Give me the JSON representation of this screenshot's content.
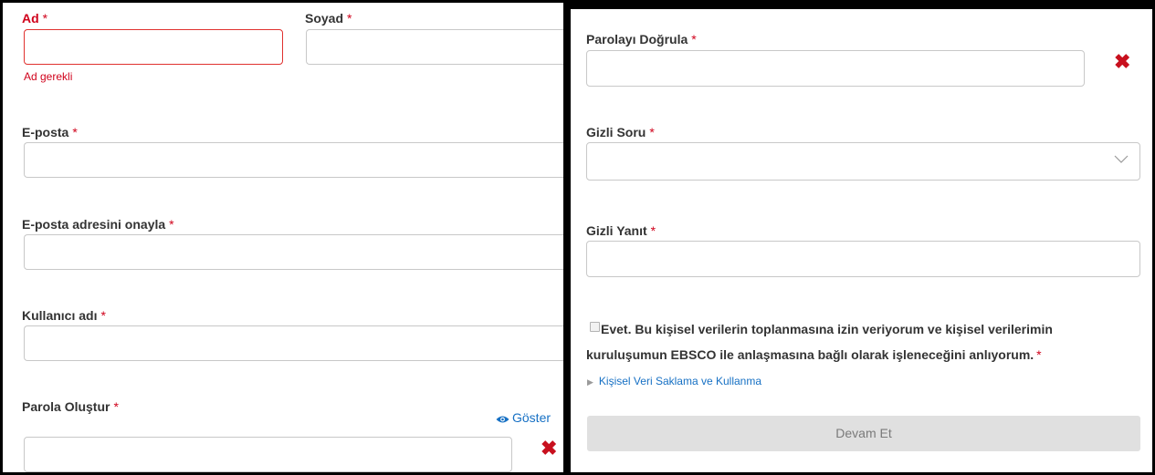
{
  "left_form": {
    "first_name": {
      "label": "Ad",
      "required": "*",
      "value": "",
      "error": "Ad gerekli"
    },
    "last_name": {
      "label": "Soyad",
      "required": "*",
      "value": ""
    },
    "email": {
      "label": "E-posta",
      "required": "*",
      "value": ""
    },
    "email_confirm": {
      "label": "E-posta adresini onayla",
      "required": "*",
      "value": ""
    },
    "username": {
      "label": "Kullanıcı adı",
      "required": "*",
      "value": ""
    },
    "password": {
      "label": "Parola Oluştur",
      "required": "*",
      "value": "",
      "show_label": "Göster"
    }
  },
  "right_form": {
    "password_confirm": {
      "label": "Parolayı Doğrula",
      "required": "*",
      "value": ""
    },
    "secret_question": {
      "label": "Gizli Soru",
      "required": "*",
      "selected": ""
    },
    "secret_answer": {
      "label": "Gizli Yanıt",
      "required": "*",
      "value": ""
    },
    "consent": {
      "text": "Evet. Bu kişisel verilerin toplanmasına izin veriyorum ve kişisel verilerimin kuruluşumun EBSCO ile anlaşmasına bağlı olarak işleneceğini anlıyorum.",
      "required": "*",
      "checked": false
    },
    "privacy_link": "Kişisel Veri Saklama ve Kullanma",
    "submit_label": "Devam Et"
  },
  "colors": {
    "error": "#d0021b",
    "link": "#1670c4",
    "clear_icon": "#c8101e",
    "button_bg": "#e0e0e0"
  },
  "icons": {
    "clear": "x-mark-icon",
    "show_password": "eye-icon",
    "dropdown": "chevron-down-icon",
    "disclosure": "triangle-right-icon"
  }
}
